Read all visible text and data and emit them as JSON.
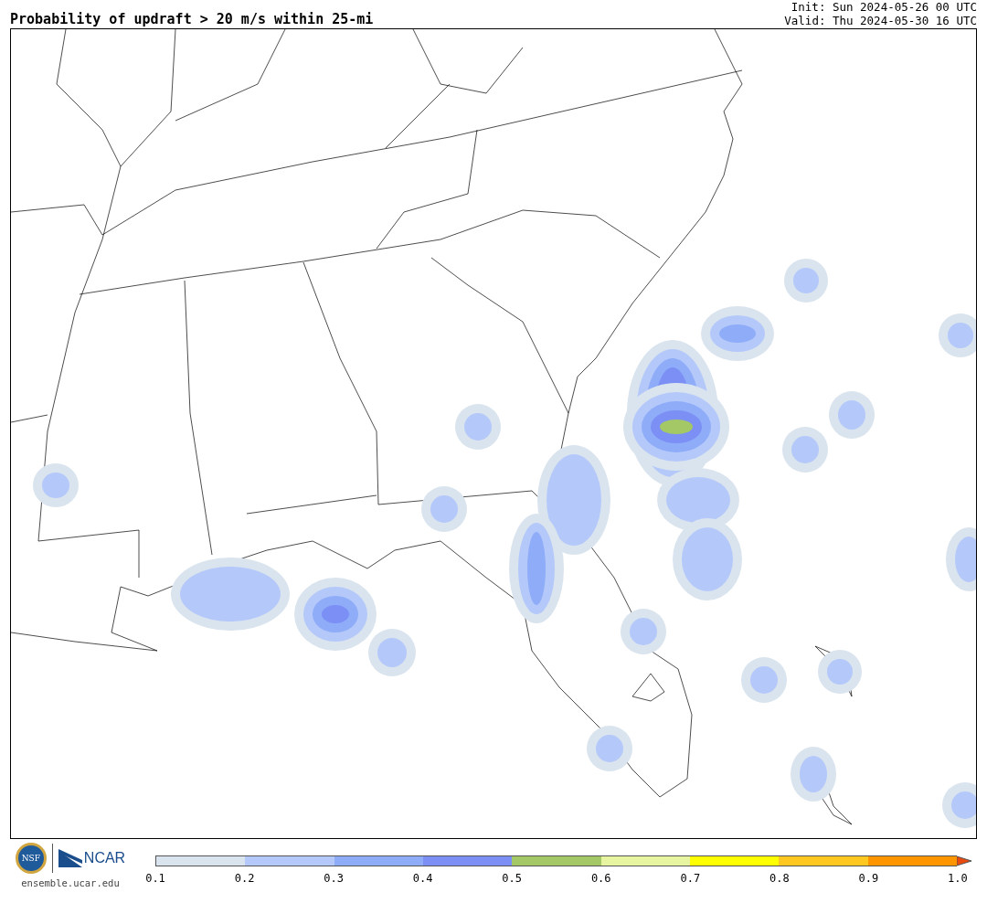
{
  "title": "Probability of updraft > 20 m/s within 25-mi",
  "init": "Init: Sun 2024-05-26 00 UTC",
  "valid": "Valid: Thu 2024-05-30 16 UTC",
  "logos": {
    "seal": "NSF",
    "wordmark": "NCAR",
    "site": "ensemble.ucar.edu"
  },
  "colorbar": {
    "segments": [
      {
        "color": "#dae4ee"
      },
      {
        "color": "#b4c8fa"
      },
      {
        "color": "#8eacf8"
      },
      {
        "color": "#7b8ff5"
      },
      {
        "color": "#a4c866"
      },
      {
        "color": "#e8f5a0"
      },
      {
        "color": "#ffff00"
      },
      {
        "color": "#ffc820"
      },
      {
        "color": "#ff9600"
      }
    ],
    "arrow": {
      "color": "#e84a10"
    },
    "ticks": [
      "0.1",
      "0.2",
      "0.3",
      "0.4",
      "0.5",
      "0.6",
      "0.7",
      "0.8",
      "0.9",
      "1.0"
    ]
  }
}
